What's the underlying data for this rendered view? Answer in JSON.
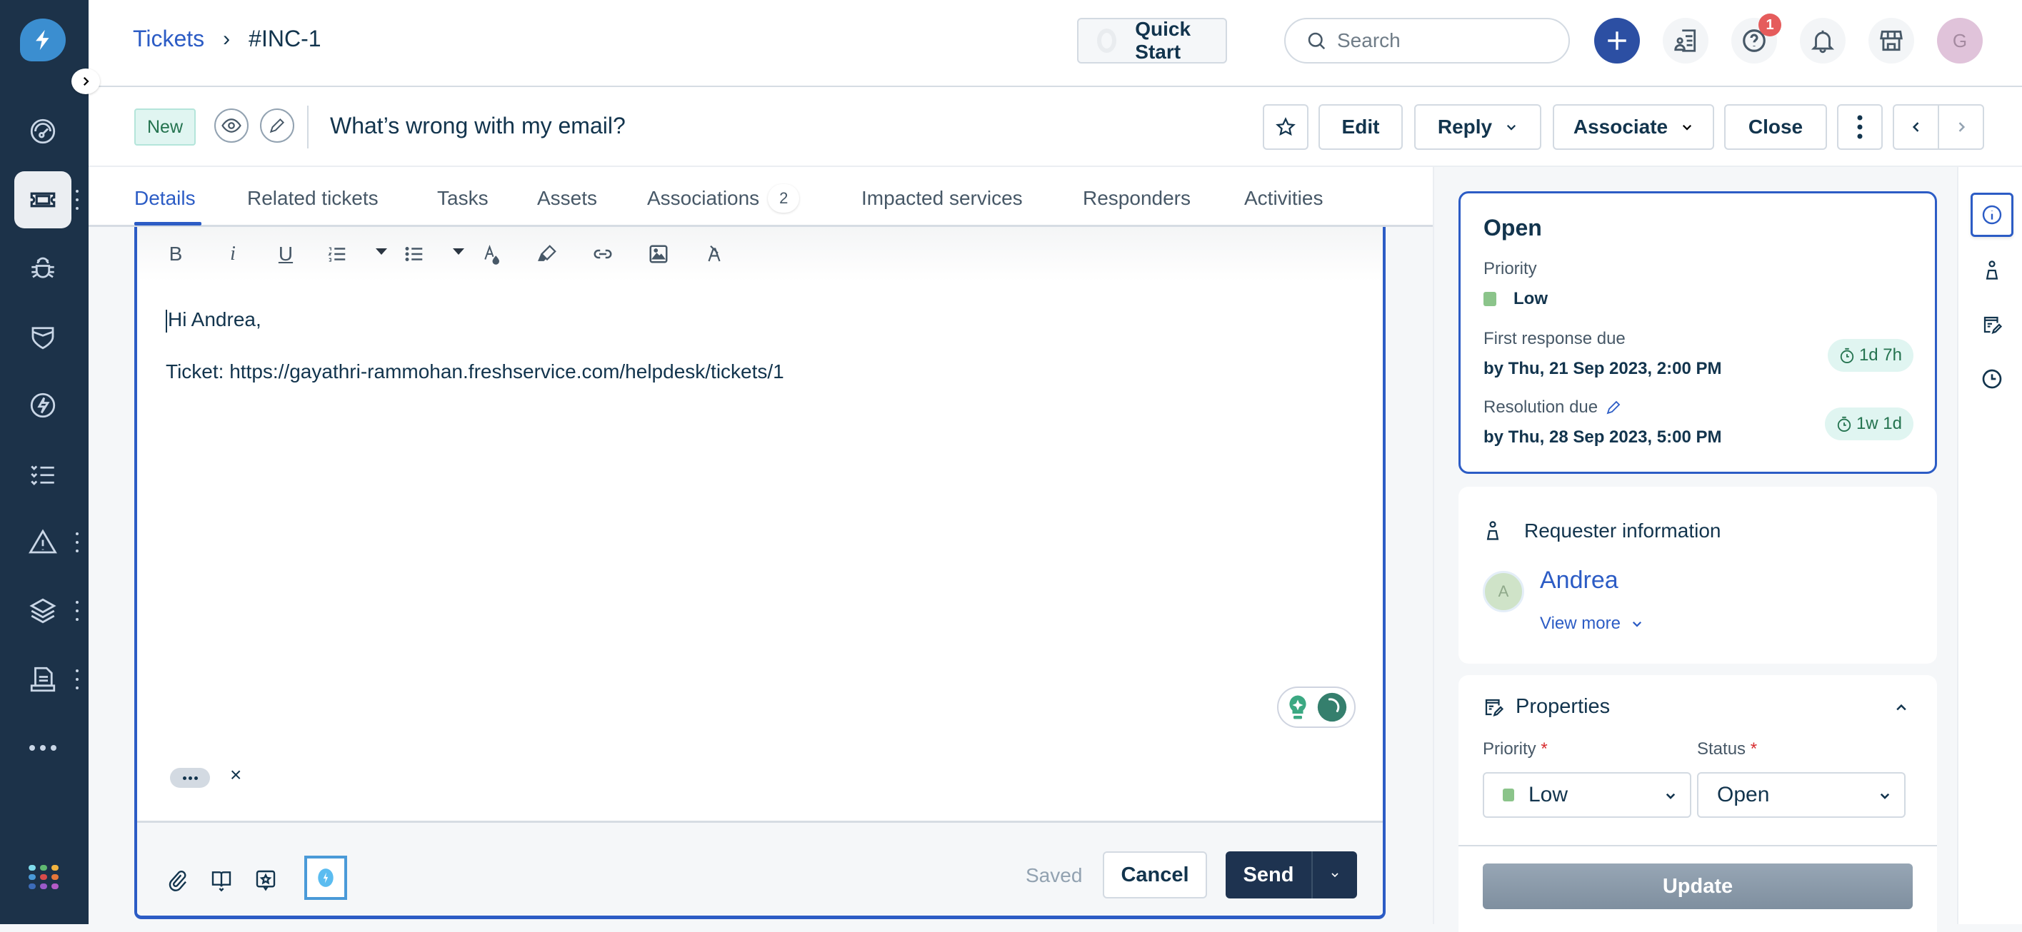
{
  "left_nav": {
    "items": [
      {
        "name": "dashboard",
        "active": false,
        "has_menu": false
      },
      {
        "name": "tickets",
        "active": true,
        "has_menu": true
      },
      {
        "name": "problems",
        "active": false,
        "has_menu": false
      },
      {
        "name": "changes",
        "active": false,
        "has_menu": false
      },
      {
        "name": "releases",
        "active": false,
        "has_menu": false
      },
      {
        "name": "tasks",
        "active": false,
        "has_menu": false
      },
      {
        "name": "alerts",
        "active": false,
        "has_menu": true
      },
      {
        "name": "assets",
        "active": false,
        "has_menu": true
      },
      {
        "name": "reports",
        "active": false,
        "has_menu": true
      },
      {
        "name": "more",
        "active": false,
        "has_menu": false
      }
    ],
    "app_grid_colors": [
      "#7fdcec",
      "#5fb971",
      "#f1b33f",
      "#4a9ad8",
      "#d94b4b",
      "#e6773a",
      "#3c6bb8",
      "#9a5ac8",
      "#b35bc6"
    ]
  },
  "header": {
    "breadcrumb": {
      "parent": "Tickets",
      "separator": "›",
      "current": "#INC-1"
    },
    "quick_start_label": "Quick Start",
    "search_placeholder": "Search",
    "help_badge_count": "1",
    "avatar_initial": "G"
  },
  "ticket": {
    "status_pill": "New",
    "title": "What’s wrong with my email?",
    "actions": {
      "edit": "Edit",
      "reply": "Reply",
      "associate": "Associate",
      "close": "Close"
    }
  },
  "tabs": [
    {
      "label": "Details",
      "active": true
    },
    {
      "label": "Related tickets"
    },
    {
      "label": "Tasks"
    },
    {
      "label": "Assets"
    },
    {
      "label": "Associations",
      "count": "2"
    },
    {
      "label": "Impacted services"
    },
    {
      "label": "Responders"
    },
    {
      "label": "Activities"
    }
  ],
  "editor": {
    "toolbar": [
      "bold",
      "italic",
      "underline",
      "ordered-list",
      "bullet-list",
      "text-color",
      "highlight",
      "link",
      "image",
      "clear-format"
    ],
    "body": [
      "Hi Andrea,",
      "Ticket: https://gayathri-rammohan.freshservice.com/helpdesk/tickets/1"
    ],
    "quote_close": "×",
    "saved_label": "Saved",
    "cancel_label": "Cancel",
    "send_label": "Send"
  },
  "status_card": {
    "status": "Open",
    "priority_label": "Priority",
    "priority_value": "Low",
    "priority_color": "#8bc48a",
    "first_response_label": "First response due",
    "first_response_value": "by Thu, 21 Sep 2023, 2:00 PM",
    "first_response_timer": "1d 7h",
    "resolution_label": "Resolution due",
    "resolution_value": "by Thu, 28 Sep 2023, 5:00 PM",
    "resolution_timer": "1w 1d"
  },
  "requester": {
    "heading": "Requester information",
    "name": "Andrea",
    "initial": "A",
    "view_more": "View more"
  },
  "properties": {
    "heading": "Properties",
    "priority_label": "Priority",
    "priority_value": "Low",
    "status_label": "Status",
    "status_value": "Open",
    "required_mark": "*",
    "update_label": "Update"
  },
  "colors": {
    "accent": "#2c5cc5",
    "nav_bg": "#1c3249",
    "send_bg": "#1e3350",
    "timer_green": "#24734f"
  }
}
